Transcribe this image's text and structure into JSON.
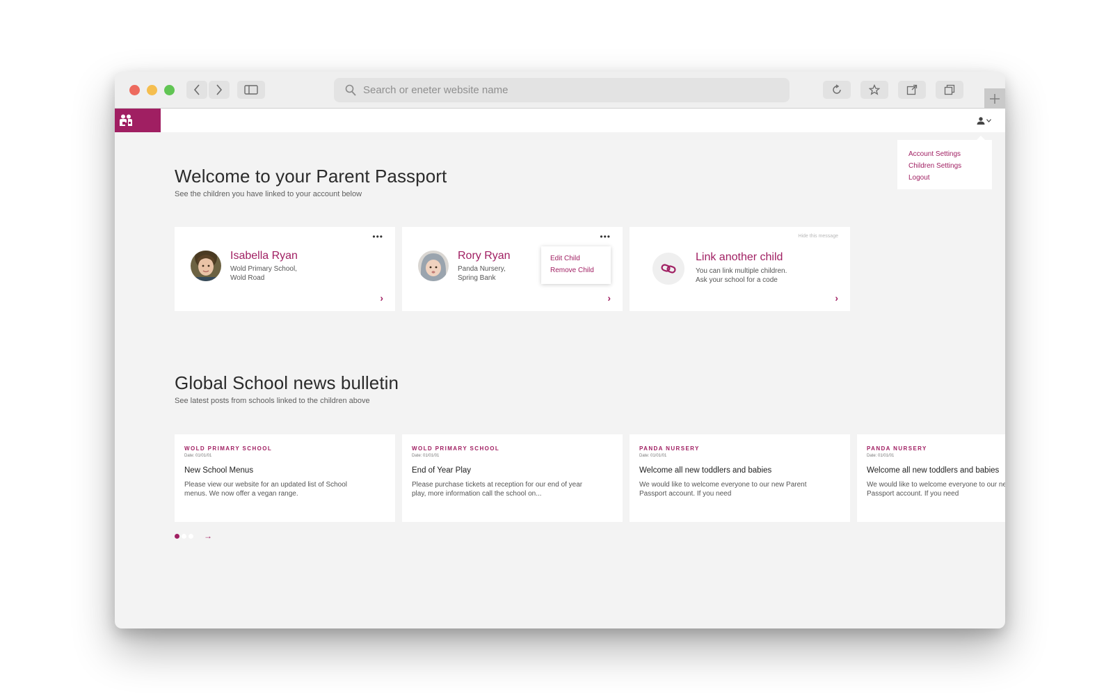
{
  "browser": {
    "url_placeholder": "Search or eneter website name"
  },
  "account_menu": {
    "items": [
      "Account Settings",
      "Children Settings",
      "Logout"
    ]
  },
  "welcome": {
    "title": "Welcome to your Parent Passport",
    "subtitle": "See the children you have linked to your account below"
  },
  "children": [
    {
      "name": "Isabella Ryan",
      "school_line1": "Wold Primary School,",
      "school_line2": "Wold Road"
    },
    {
      "name": "Rory Ryan",
      "school_line1": "Panda Nursery,",
      "school_line2": "Spring Bank"
    }
  ],
  "child_menu": {
    "edit": "Edit Child",
    "remove": "Remove Child"
  },
  "link_card": {
    "hide": "Hide this message",
    "title": "Link another child",
    "line1": "You can link multiple children.",
    "line2": "Ask your school for a code"
  },
  "bulletin": {
    "title": "Global School news bulletin",
    "subtitle": "See latest posts from schools linked to the children above",
    "posts": [
      {
        "school": "WOLD PRIMARY SCHOOL",
        "date": "Date: 01/01/01",
        "title": "New School Menus",
        "body": "Please view our website for an updated list of School menus. We now offer a vegan range."
      },
      {
        "school": "WOLD PRIMARY SCHOOL",
        "date": "Date: 01/01/01",
        "title": "End of Year Play",
        "body": "Please purchase tickets at reception for our end of year play, more information call the school on..."
      },
      {
        "school": "PANDA NURSERY",
        "date": "Date: 01/01/01",
        "title": "Welcome all new toddlers and babies",
        "body": "We would like to welcome everyone to our new Parent Passport account. If you need"
      },
      {
        "school": "PANDA NURSERY",
        "date": "Date: 01/01/01",
        "title": "Welcome all new toddlers and babies",
        "body": "We would like to welcome everyone to our new Parent Passport account. If you need"
      }
    ],
    "pagination": {
      "pages": 3,
      "current": 1
    }
  },
  "colors": {
    "brand": "#a01f62",
    "background": "#f3f3f3"
  },
  "icons": [
    "search-icon",
    "back-icon",
    "forward-icon",
    "sidebar-icon",
    "reload-icon",
    "bookmark-icon",
    "share-icon",
    "tabs-icon",
    "plus-icon",
    "family-logo-icon",
    "user-icon",
    "link-icon"
  ]
}
